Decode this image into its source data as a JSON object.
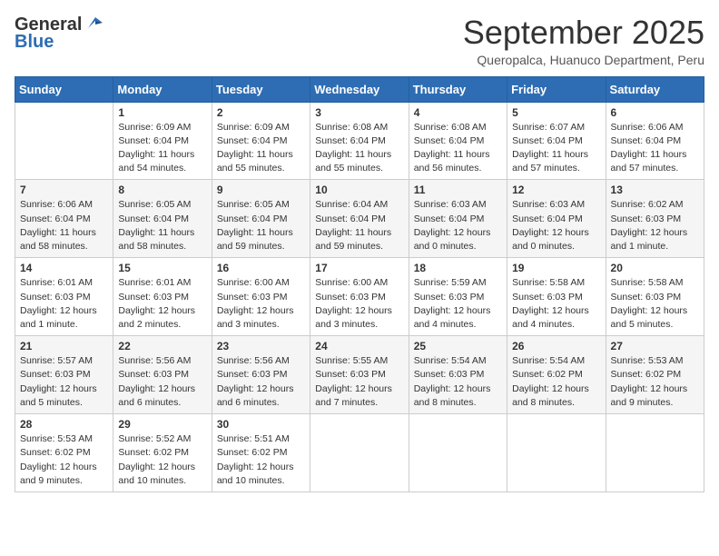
{
  "header": {
    "logo_general": "General",
    "logo_blue": "Blue",
    "month": "September 2025",
    "location": "Queropalca, Huanuco Department, Peru"
  },
  "weekdays": [
    "Sunday",
    "Monday",
    "Tuesday",
    "Wednesday",
    "Thursday",
    "Friday",
    "Saturday"
  ],
  "weeks": [
    [
      {
        "day": "",
        "info": ""
      },
      {
        "day": "1",
        "info": "Sunrise: 6:09 AM\nSunset: 6:04 PM\nDaylight: 11 hours\nand 54 minutes."
      },
      {
        "day": "2",
        "info": "Sunrise: 6:09 AM\nSunset: 6:04 PM\nDaylight: 11 hours\nand 55 minutes."
      },
      {
        "day": "3",
        "info": "Sunrise: 6:08 AM\nSunset: 6:04 PM\nDaylight: 11 hours\nand 55 minutes."
      },
      {
        "day": "4",
        "info": "Sunrise: 6:08 AM\nSunset: 6:04 PM\nDaylight: 11 hours\nand 56 minutes."
      },
      {
        "day": "5",
        "info": "Sunrise: 6:07 AM\nSunset: 6:04 PM\nDaylight: 11 hours\nand 57 minutes."
      },
      {
        "day": "6",
        "info": "Sunrise: 6:06 AM\nSunset: 6:04 PM\nDaylight: 11 hours\nand 57 minutes."
      }
    ],
    [
      {
        "day": "7",
        "info": "Sunrise: 6:06 AM\nSunset: 6:04 PM\nDaylight: 11 hours\nand 58 minutes."
      },
      {
        "day": "8",
        "info": "Sunrise: 6:05 AM\nSunset: 6:04 PM\nDaylight: 11 hours\nand 58 minutes."
      },
      {
        "day": "9",
        "info": "Sunrise: 6:05 AM\nSunset: 6:04 PM\nDaylight: 11 hours\nand 59 minutes."
      },
      {
        "day": "10",
        "info": "Sunrise: 6:04 AM\nSunset: 6:04 PM\nDaylight: 11 hours\nand 59 minutes."
      },
      {
        "day": "11",
        "info": "Sunrise: 6:03 AM\nSunset: 6:04 PM\nDaylight: 12 hours\nand 0 minutes."
      },
      {
        "day": "12",
        "info": "Sunrise: 6:03 AM\nSunset: 6:04 PM\nDaylight: 12 hours\nand 0 minutes."
      },
      {
        "day": "13",
        "info": "Sunrise: 6:02 AM\nSunset: 6:03 PM\nDaylight: 12 hours\nand 1 minute."
      }
    ],
    [
      {
        "day": "14",
        "info": "Sunrise: 6:01 AM\nSunset: 6:03 PM\nDaylight: 12 hours\nand 1 minute."
      },
      {
        "day": "15",
        "info": "Sunrise: 6:01 AM\nSunset: 6:03 PM\nDaylight: 12 hours\nand 2 minutes."
      },
      {
        "day": "16",
        "info": "Sunrise: 6:00 AM\nSunset: 6:03 PM\nDaylight: 12 hours\nand 3 minutes."
      },
      {
        "day": "17",
        "info": "Sunrise: 6:00 AM\nSunset: 6:03 PM\nDaylight: 12 hours\nand 3 minutes."
      },
      {
        "day": "18",
        "info": "Sunrise: 5:59 AM\nSunset: 6:03 PM\nDaylight: 12 hours\nand 4 minutes."
      },
      {
        "day": "19",
        "info": "Sunrise: 5:58 AM\nSunset: 6:03 PM\nDaylight: 12 hours\nand 4 minutes."
      },
      {
        "day": "20",
        "info": "Sunrise: 5:58 AM\nSunset: 6:03 PM\nDaylight: 12 hours\nand 5 minutes."
      }
    ],
    [
      {
        "day": "21",
        "info": "Sunrise: 5:57 AM\nSunset: 6:03 PM\nDaylight: 12 hours\nand 5 minutes."
      },
      {
        "day": "22",
        "info": "Sunrise: 5:56 AM\nSunset: 6:03 PM\nDaylight: 12 hours\nand 6 minutes."
      },
      {
        "day": "23",
        "info": "Sunrise: 5:56 AM\nSunset: 6:03 PM\nDaylight: 12 hours\nand 6 minutes."
      },
      {
        "day": "24",
        "info": "Sunrise: 5:55 AM\nSunset: 6:03 PM\nDaylight: 12 hours\nand 7 minutes."
      },
      {
        "day": "25",
        "info": "Sunrise: 5:54 AM\nSunset: 6:03 PM\nDaylight: 12 hours\nand 8 minutes."
      },
      {
        "day": "26",
        "info": "Sunrise: 5:54 AM\nSunset: 6:02 PM\nDaylight: 12 hours\nand 8 minutes."
      },
      {
        "day": "27",
        "info": "Sunrise: 5:53 AM\nSunset: 6:02 PM\nDaylight: 12 hours\nand 9 minutes."
      }
    ],
    [
      {
        "day": "28",
        "info": "Sunrise: 5:53 AM\nSunset: 6:02 PM\nDaylight: 12 hours\nand 9 minutes."
      },
      {
        "day": "29",
        "info": "Sunrise: 5:52 AM\nSunset: 6:02 PM\nDaylight: 12 hours\nand 10 minutes."
      },
      {
        "day": "30",
        "info": "Sunrise: 5:51 AM\nSunset: 6:02 PM\nDaylight: 12 hours\nand 10 minutes."
      },
      {
        "day": "",
        "info": ""
      },
      {
        "day": "",
        "info": ""
      },
      {
        "day": "",
        "info": ""
      },
      {
        "day": "",
        "info": ""
      }
    ]
  ]
}
